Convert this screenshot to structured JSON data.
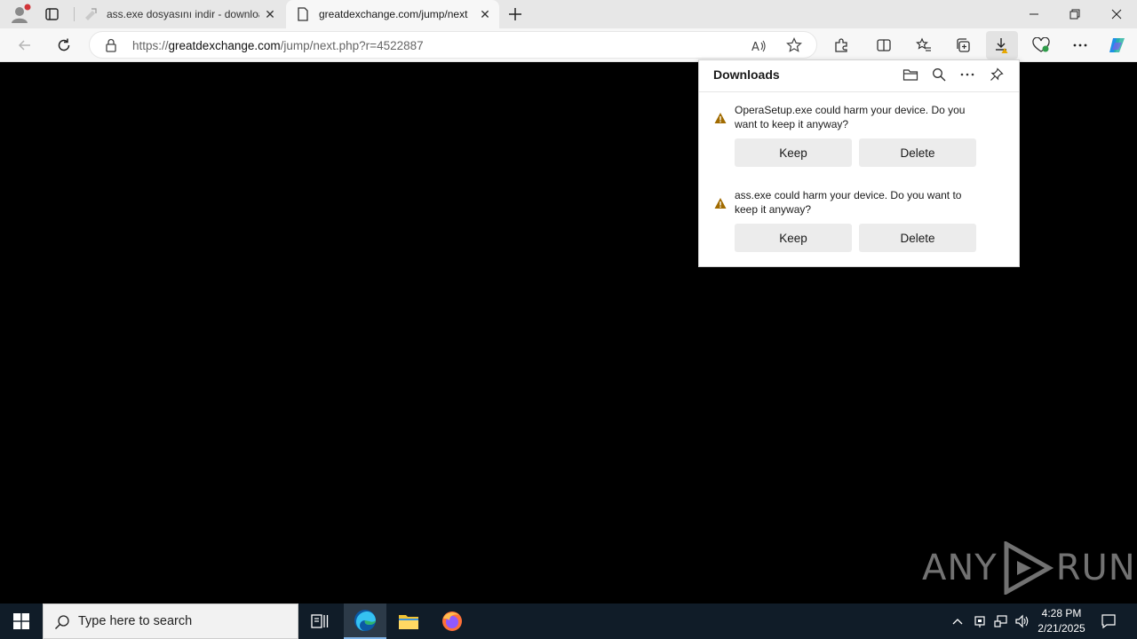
{
  "browser": {
    "tabs": [
      {
        "title": "ass.exe dosyasını indir - downloa",
        "favicon": "script-icon"
      },
      {
        "title": "greatdexchange.com/jump/next",
        "favicon": "page-icon"
      }
    ],
    "address": {
      "prefix": "https://",
      "host": "greatdexchange.com",
      "path": "/jump/next.php?r=4522887"
    }
  },
  "downloads": {
    "title": "Downloads",
    "items": [
      {
        "message": "OperaSetup.exe could harm your device. Do you want to keep it anyway?",
        "keep_label": "Keep",
        "delete_label": "Delete"
      },
      {
        "message": "ass.exe could harm your device. Do you want to keep it anyway?",
        "keep_label": "Keep",
        "delete_label": "Delete"
      }
    ]
  },
  "watermark": {
    "left": "ANY",
    "right": "RUN"
  },
  "taskbar": {
    "search_placeholder": "Type here to search",
    "time": "4:28 PM",
    "date": "2/21/2025"
  },
  "colors": {
    "warning": "#a16b00",
    "taskbar_bg": "#101c28",
    "accent": "#0067c0"
  }
}
